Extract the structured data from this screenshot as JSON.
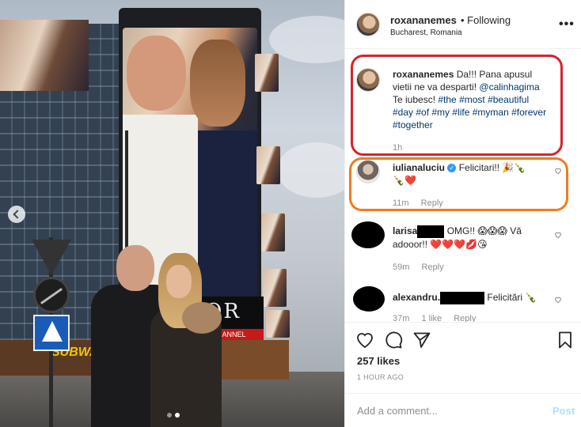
{
  "post": {
    "author": "roxananemes",
    "follow_status": "• Following",
    "location": "Bucharest, Romania",
    "more": "•••",
    "store_sign": "SUBWAY",
    "billboard_text": "OR",
    "billboard_channel": "IACHANNEL"
  },
  "caption": {
    "user": "roxananemes",
    "text_start": "Da!!! Pana apusul vietii ne va desparti!",
    "mention": "@calinhagima",
    "text_after_mention": "Te iubesc!",
    "hashtags": "#the #most #beautiful #day #of #my #life #myman #forever #together",
    "time": "1h"
  },
  "comments": [
    {
      "user": "iulianaluciu",
      "verified": "✓",
      "text": "Felicitari!! 🎉🍾",
      "text2": "🍾❤️",
      "time": "11m",
      "reply": "Reply"
    },
    {
      "user": "larisa",
      "text": "OMG!! 😱😱😱 Vă",
      "text2": "adooor!! ❤️❤️❤️💋😘",
      "time": "59m",
      "reply": "Reply"
    },
    {
      "user": "alexandru.",
      "text": "Felicitări 🍾",
      "time": "37m",
      "likes": "1 like",
      "reply": "Reply"
    }
  ],
  "likes": "257 likes",
  "timestamp": "1 HOUR AGO",
  "add_comment": {
    "placeholder": "Add a comment...",
    "post": "Post"
  },
  "colors": {
    "annotation_red": "#d8232a",
    "annotation_orange": "#f07b22",
    "link": "#00376b",
    "verified": "#3897f0"
  }
}
